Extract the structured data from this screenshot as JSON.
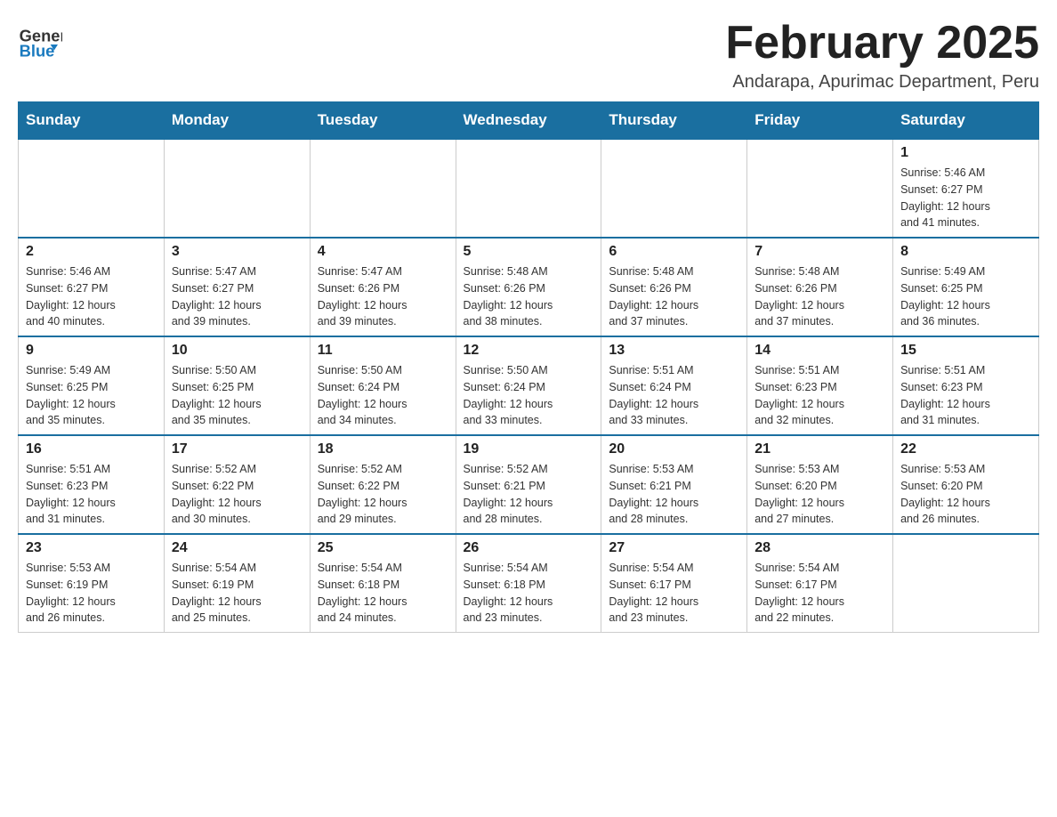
{
  "header": {
    "logo_general": "General",
    "logo_blue": "Blue",
    "month_title": "February 2025",
    "location": "Andarapa, Apurimac Department, Peru"
  },
  "weekdays": [
    "Sunday",
    "Monday",
    "Tuesday",
    "Wednesday",
    "Thursday",
    "Friday",
    "Saturday"
  ],
  "weeks": [
    [
      {
        "day": "",
        "info": ""
      },
      {
        "day": "",
        "info": ""
      },
      {
        "day": "",
        "info": ""
      },
      {
        "day": "",
        "info": ""
      },
      {
        "day": "",
        "info": ""
      },
      {
        "day": "",
        "info": ""
      },
      {
        "day": "1",
        "info": "Sunrise: 5:46 AM\nSunset: 6:27 PM\nDaylight: 12 hours\nand 41 minutes."
      }
    ],
    [
      {
        "day": "2",
        "info": "Sunrise: 5:46 AM\nSunset: 6:27 PM\nDaylight: 12 hours\nand 40 minutes."
      },
      {
        "day": "3",
        "info": "Sunrise: 5:47 AM\nSunset: 6:27 PM\nDaylight: 12 hours\nand 39 minutes."
      },
      {
        "day": "4",
        "info": "Sunrise: 5:47 AM\nSunset: 6:26 PM\nDaylight: 12 hours\nand 39 minutes."
      },
      {
        "day": "5",
        "info": "Sunrise: 5:48 AM\nSunset: 6:26 PM\nDaylight: 12 hours\nand 38 minutes."
      },
      {
        "day": "6",
        "info": "Sunrise: 5:48 AM\nSunset: 6:26 PM\nDaylight: 12 hours\nand 37 minutes."
      },
      {
        "day": "7",
        "info": "Sunrise: 5:48 AM\nSunset: 6:26 PM\nDaylight: 12 hours\nand 37 minutes."
      },
      {
        "day": "8",
        "info": "Sunrise: 5:49 AM\nSunset: 6:25 PM\nDaylight: 12 hours\nand 36 minutes."
      }
    ],
    [
      {
        "day": "9",
        "info": "Sunrise: 5:49 AM\nSunset: 6:25 PM\nDaylight: 12 hours\nand 35 minutes."
      },
      {
        "day": "10",
        "info": "Sunrise: 5:50 AM\nSunset: 6:25 PM\nDaylight: 12 hours\nand 35 minutes."
      },
      {
        "day": "11",
        "info": "Sunrise: 5:50 AM\nSunset: 6:24 PM\nDaylight: 12 hours\nand 34 minutes."
      },
      {
        "day": "12",
        "info": "Sunrise: 5:50 AM\nSunset: 6:24 PM\nDaylight: 12 hours\nand 33 minutes."
      },
      {
        "day": "13",
        "info": "Sunrise: 5:51 AM\nSunset: 6:24 PM\nDaylight: 12 hours\nand 33 minutes."
      },
      {
        "day": "14",
        "info": "Sunrise: 5:51 AM\nSunset: 6:23 PM\nDaylight: 12 hours\nand 32 minutes."
      },
      {
        "day": "15",
        "info": "Sunrise: 5:51 AM\nSunset: 6:23 PM\nDaylight: 12 hours\nand 31 minutes."
      }
    ],
    [
      {
        "day": "16",
        "info": "Sunrise: 5:51 AM\nSunset: 6:23 PM\nDaylight: 12 hours\nand 31 minutes."
      },
      {
        "day": "17",
        "info": "Sunrise: 5:52 AM\nSunset: 6:22 PM\nDaylight: 12 hours\nand 30 minutes."
      },
      {
        "day": "18",
        "info": "Sunrise: 5:52 AM\nSunset: 6:22 PM\nDaylight: 12 hours\nand 29 minutes."
      },
      {
        "day": "19",
        "info": "Sunrise: 5:52 AM\nSunset: 6:21 PM\nDaylight: 12 hours\nand 28 minutes."
      },
      {
        "day": "20",
        "info": "Sunrise: 5:53 AM\nSunset: 6:21 PM\nDaylight: 12 hours\nand 28 minutes."
      },
      {
        "day": "21",
        "info": "Sunrise: 5:53 AM\nSunset: 6:20 PM\nDaylight: 12 hours\nand 27 minutes."
      },
      {
        "day": "22",
        "info": "Sunrise: 5:53 AM\nSunset: 6:20 PM\nDaylight: 12 hours\nand 26 minutes."
      }
    ],
    [
      {
        "day": "23",
        "info": "Sunrise: 5:53 AM\nSunset: 6:19 PM\nDaylight: 12 hours\nand 26 minutes."
      },
      {
        "day": "24",
        "info": "Sunrise: 5:54 AM\nSunset: 6:19 PM\nDaylight: 12 hours\nand 25 minutes."
      },
      {
        "day": "25",
        "info": "Sunrise: 5:54 AM\nSunset: 6:18 PM\nDaylight: 12 hours\nand 24 minutes."
      },
      {
        "day": "26",
        "info": "Sunrise: 5:54 AM\nSunset: 6:18 PM\nDaylight: 12 hours\nand 23 minutes."
      },
      {
        "day": "27",
        "info": "Sunrise: 5:54 AM\nSunset: 6:17 PM\nDaylight: 12 hours\nand 23 minutes."
      },
      {
        "day": "28",
        "info": "Sunrise: 5:54 AM\nSunset: 6:17 PM\nDaylight: 12 hours\nand 22 minutes."
      },
      {
        "day": "",
        "info": ""
      }
    ]
  ]
}
